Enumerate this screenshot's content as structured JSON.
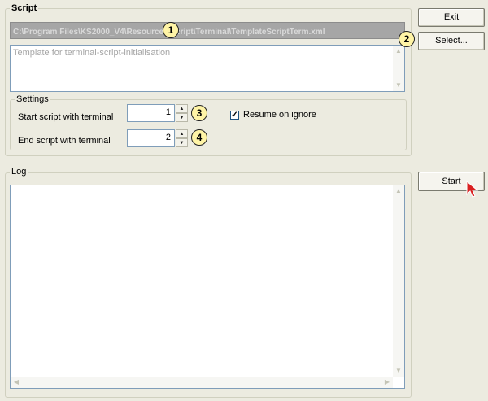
{
  "script_group": {
    "title": "Script",
    "path_value": "C:\\Program Files\\KS2000_V4\\Resources\\Script\\Terminal\\TemplateScriptTerm.xml",
    "description": "Template for terminal-script-initialisation"
  },
  "settings_group": {
    "title": "Settings",
    "start_label": "Start script with terminal",
    "start_value": "1",
    "end_label": "End script with terminal",
    "end_value": "2",
    "resume_label": "Resume on ignore",
    "resume_checked": true
  },
  "log_group": {
    "title": "Log"
  },
  "buttons": {
    "exit": "Exit",
    "select": "Select...",
    "start": "Start"
  },
  "callouts": [
    "1",
    "2",
    "3",
    "4"
  ],
  "colors": {
    "background": "#ecebe0",
    "callout_fill": "#fff4a6",
    "path_field": "#a6a6a6",
    "cursor": "#d92020"
  },
  "icons": {
    "check": "checkmark-icon",
    "cursor": "mouse-pointer-icon"
  }
}
